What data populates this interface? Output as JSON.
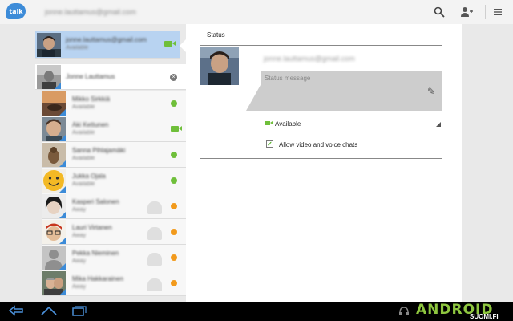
{
  "app": {
    "logo_text": "talk",
    "account_email": "jonne.lauttamus@gmail.com"
  },
  "toolbar": {
    "icons": [
      "search-icon",
      "add-friend-icon",
      "menu-icon"
    ]
  },
  "contacts": [
    {
      "name": "jonne.lauttamus@gmail.com",
      "status": "Available",
      "indicator": "video",
      "selected": true
    },
    {
      "name": "Jonne Lauttamus",
      "status": "",
      "indicator": "gray"
    },
    {
      "name": "Mikko Sirkkiä",
      "status": "Available",
      "indicator": "green"
    },
    {
      "name": "Aki Kettunen",
      "status": "Available",
      "indicator": "video"
    },
    {
      "name": "Sanna Pihlajamäki",
      "status": "Available",
      "indicator": "green"
    },
    {
      "name": "Jukka Ojala",
      "status": "Available",
      "indicator": "green"
    },
    {
      "name": "Kasperi Salonen",
      "status": "Away",
      "indicator": "orange"
    },
    {
      "name": "Lauri Virtanen",
      "status": "Away",
      "indicator": "orange"
    },
    {
      "name": "Pekka Nieminen",
      "status": "Away",
      "indicator": "orange"
    },
    {
      "name": "Mika Hakkarainen",
      "status": "Away",
      "indicator": "orange"
    }
  ],
  "detail": {
    "title": "Status",
    "email": "jonne.lauttamus@gmail.com",
    "status_placeholder": "Status message",
    "availability": "Available",
    "checkbox_label": "Allow video and voice chats",
    "checkbox_checked": true
  },
  "systembar": {
    "brand": "ANDROID",
    "brand_sub": "SUOMI.FI"
  },
  "colors": {
    "accent": "#3c8bd8",
    "online": "#6fbf3a",
    "away": "#f29a1c",
    "selected_row": "#b8d3f1"
  }
}
